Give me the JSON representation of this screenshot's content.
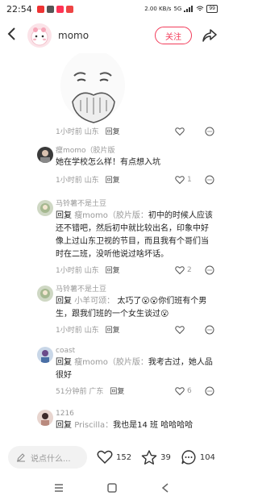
{
  "status": {
    "time": "22:54",
    "network": "2.00 KB/s",
    "signal": "5G",
    "battery": "99"
  },
  "header": {
    "name": "momo",
    "follow_label": "关注"
  },
  "top_comment_meta": {
    "time_loc": "1小时前 山东",
    "reply_label": "回复",
    "likes": ""
  },
  "comments": [
    {
      "author": "瘦momo（胶片版",
      "text": "她在学校怎么样！有点想入坑",
      "time_loc": "1小时前 山东",
      "reply_label": "回复",
      "likes": "1"
    },
    {
      "author": "马铃薯不是土豆",
      "reply_word": "回复",
      "target": "瘦momo（胶片版：",
      "text": "初中的时候人应该还不错吧，然后初中就比较出名，印象中好像上过山东卫视的节目，而且我有个哥们当时在二班，没听他说过啥坏话。",
      "time_loc": "1小时前 山东",
      "reply_label": "回复",
      "likes": "2"
    },
    {
      "author": "马铃薯不是土豆",
      "reply_word": "回复",
      "target": "小羊可颂：",
      "text": "太巧了😮😮你们班有个男生，跟我们班的一个女生谈过😮",
      "time_loc": "1小时前 山东",
      "reply_label": "回复",
      "likes": ""
    },
    {
      "author": "coast",
      "reply_word": "回复",
      "target": "瘦momo（胶片版：",
      "text": "我考古过，她人品很好",
      "time_loc": "51分钟前 广东",
      "reply_label": "回复",
      "likes": "6"
    },
    {
      "author": "1216",
      "reply_word": "回复",
      "target": "Priscilla：",
      "text": "我也是14 班 哈哈哈哈",
      "time_loc": "",
      "reply_label": "",
      "likes": ""
    }
  ],
  "bottom": {
    "placeholder": "说点什么...",
    "likes": "152",
    "stars": "39",
    "comments": "104"
  },
  "icons": {
    "back": "chevron-left-icon",
    "share": "share-icon",
    "heart": "heart-icon",
    "chat": "chat-icon",
    "star": "star-icon",
    "pencil": "pencil-icon"
  },
  "colors": {
    "accent": "#f23c5a"
  }
}
